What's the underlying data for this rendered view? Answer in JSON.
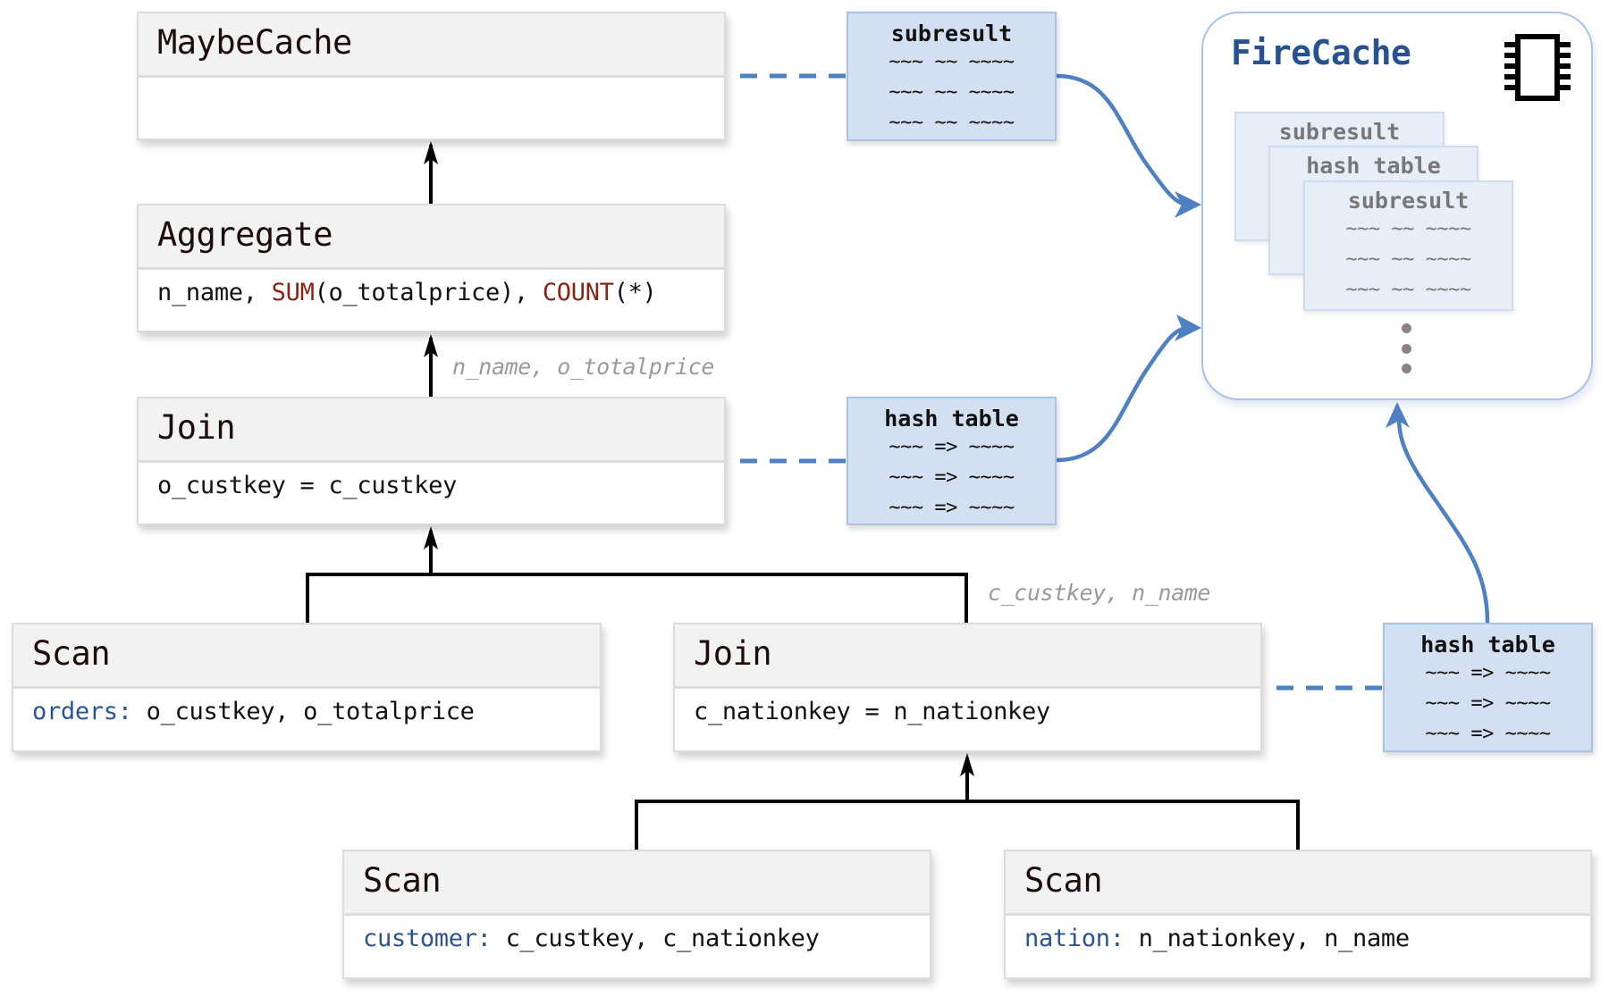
{
  "operators": {
    "maybecache": {
      "title": "MaybeCache",
      "body": ""
    },
    "aggregate": {
      "title": "Aggregate",
      "body": {
        "p1": "n_name, ",
        "fn1": "SUM",
        "p2": "(o_totalprice), ",
        "fn2": "COUNT",
        "p3": "(*)"
      }
    },
    "join_top": {
      "title": "Join",
      "body": "o_custkey = c_custkey"
    },
    "scan_orders": {
      "title": "Scan",
      "table": "orders:",
      "columns": " o_custkey, o_totalprice"
    },
    "join_bottom": {
      "title": "Join",
      "body": "c_nationkey = n_nationkey"
    },
    "scan_customer": {
      "title": "Scan",
      "table": "customer:",
      "columns": " c_custkey, c_nationkey"
    },
    "scan_nation": {
      "title": "Scan",
      "table": "nation:",
      "columns": " n_nationkey, n_name"
    }
  },
  "edge_labels": {
    "join_to_aggregate": "n_name, o_totalprice",
    "join_bottom_to_join_top": "c_custkey, n_name"
  },
  "memo_boxes": {
    "subresult": {
      "title": "subresult",
      "rows": [
        "~~~ ~~ ~~~~",
        "~~~ ~~ ~~~~",
        "~~~ ~~ ~~~~"
      ]
    },
    "hash_table_mid": {
      "title": "hash table",
      "rows": [
        "~~~ => ~~~~",
        "~~~ => ~~~~",
        "~~~ => ~~~~"
      ]
    },
    "hash_table_bottom": {
      "title": "hash table",
      "rows": [
        "~~~ => ~~~~",
        "~~~ => ~~~~",
        "~~~ => ~~~~"
      ]
    }
  },
  "firecache": {
    "title": "FireCache",
    "icon": "memory-chip-icon",
    "cards": [
      {
        "title": "subresult",
        "rows": [
          "~~~ ~~ ~~~~",
          "~~~ ~~ ~~~~",
          "~~~ ~~ ~~~~"
        ]
      },
      {
        "title": "hash table",
        "rows": [
          "~~~ => ~~~~",
          "~~~ => ~~~~",
          "~~~ => ~~~~"
        ]
      },
      {
        "title": "subresult",
        "rows": [
          "~~~ ~~ ~~~~",
          "~~~ ~~ ~~~~",
          "~~~ ~~ ~~~~"
        ]
      }
    ],
    "more_indicator": "vertical-ellipsis"
  },
  "colors": {
    "accent_blue": "#4f81c2",
    "memo_fill": "#d3e0f1",
    "memo_border": "#a9c3e6",
    "keyword_red": "#8b2212",
    "table_blue": "#2a5590",
    "title_blue": "#27528f",
    "label_grey": "#9a9a9a",
    "header_fill": "#f2f2f2"
  }
}
